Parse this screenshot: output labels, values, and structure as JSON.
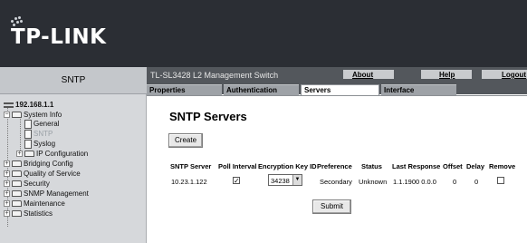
{
  "header": {
    "logo_text": "TP-LINK",
    "page_label": "SNTP",
    "device_name": "TL-SL3428 L2 Management Switch",
    "links": {
      "about": "About",
      "help": "Help",
      "logout": "Logout"
    }
  },
  "tabs": [
    {
      "label": "Properties",
      "active": false
    },
    {
      "label": "Authentication",
      "active": false
    },
    {
      "label": "Servers",
      "active": true
    },
    {
      "label": "Interface",
      "active": false
    }
  ],
  "sidebar": {
    "root": "192.168.1.1",
    "items": [
      {
        "label": "System Info",
        "type": "folder",
        "expanded": true
      },
      {
        "label": "General",
        "type": "doc"
      },
      {
        "label": "SNTP",
        "type": "doc",
        "selected": true
      },
      {
        "label": "Syslog",
        "type": "doc"
      },
      {
        "label": "IP Configuration",
        "type": "folder"
      },
      {
        "label": "Bridging Config",
        "type": "folder"
      },
      {
        "label": "Quality of Service",
        "type": "folder"
      },
      {
        "label": "Security",
        "type": "folder"
      },
      {
        "label": "SNMP Management",
        "type": "folder"
      },
      {
        "label": "Maintenance",
        "type": "folder"
      },
      {
        "label": "Statistics",
        "type": "folder"
      }
    ]
  },
  "main": {
    "title": "SNTP Servers",
    "create_label": "Create",
    "submit_label": "Submit",
    "columns": [
      "SNTP Server",
      "Poll Interval",
      "Encryption Key ID",
      "Preference",
      "Status",
      "Last Response",
      "Offset",
      "Delay",
      "Remove"
    ],
    "row": {
      "server": "10.23.1.122",
      "poll_checked": true,
      "key_id": "34238",
      "preference": "Secondary",
      "status": "Unknown",
      "last_response": "1.1.1900 0.0.0",
      "offset": "0",
      "delay": "0",
      "remove_checked": false
    }
  }
}
